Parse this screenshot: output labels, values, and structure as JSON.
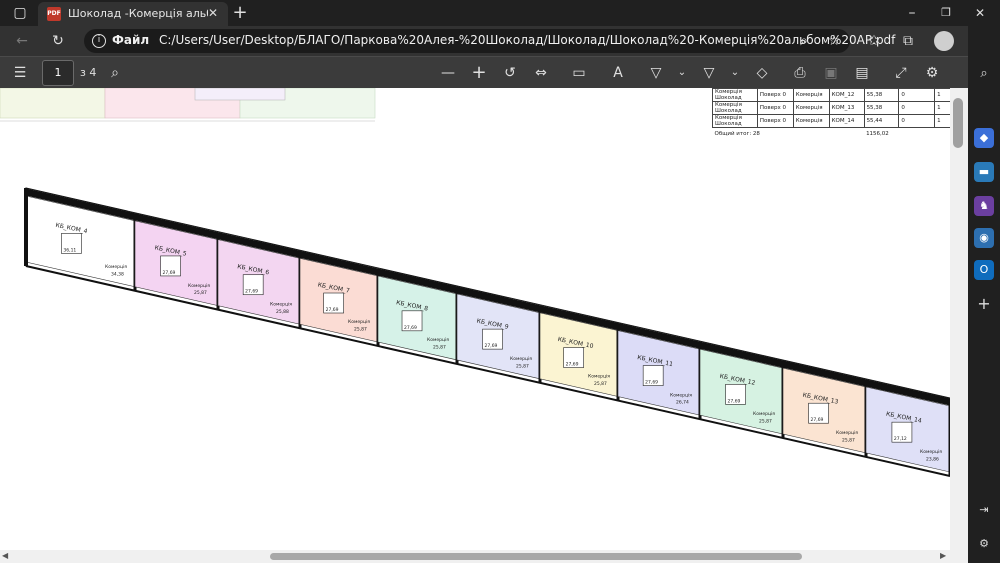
{
  "tab": {
    "title": "Шоколад -Комерція альбом АР"
  },
  "address": {
    "label": "Файл",
    "url": "C:/Users/User/Desktop/БЛАГО/Паркова%20Алея-%20Шоколад/Шоколад/Шоколад%20-Комерція%20альбом%20АР.pdf"
  },
  "pdf": {
    "page": "1",
    "of": "з 4"
  },
  "schedule": {
    "rows": [
      {
        "a": "Комерція Шоколад",
        "b": "Поверх 0",
        "c": "Комерція",
        "d": "КОМ_12",
        "e": "55,38",
        "f": "0",
        "g": "1"
      },
      {
        "a": "Комерція Шоколад",
        "b": "Поверх 0",
        "c": "Комерція",
        "d": "КОМ_13",
        "e": "55,38",
        "f": "0",
        "g": "1"
      },
      {
        "a": "Комерція Шоколад",
        "b": "Поверх 0",
        "c": "Комерція",
        "d": "КОМ_14",
        "e": "55,44",
        "f": "0",
        "g": "1"
      }
    ],
    "total_label": "Общий итог: 28",
    "total_value": "1156,02"
  },
  "units": [
    {
      "name": "КБ_КОМ_4",
      "area": "36,11",
      "label": "Комерція",
      "label_area": "34,38",
      "color": "#ffffff"
    },
    {
      "name": "КБ_КОМ_5",
      "area": "27,69",
      "label": "Комерція",
      "label_area": "25,87",
      "color": "#f4d4f2"
    },
    {
      "name": "КБ_КОМ_6",
      "area": "27,69",
      "label": "Комерція",
      "label_area": "25,88",
      "color": "#f3d6f1"
    },
    {
      "name": "КБ_КОМ_7",
      "area": "27,69",
      "label": "Комерція",
      "label_area": "25,87",
      "color": "#fbdcd4"
    },
    {
      "name": "КБ_КОМ_8",
      "area": "27,69",
      "label": "Комерція",
      "label_area": "25,87",
      "color": "#d6f2e8"
    },
    {
      "name": "КБ_КОМ_9",
      "area": "27,69",
      "label": "Комерція",
      "label_area": "25,87",
      "color": "#e2e4f7"
    },
    {
      "name": "КБ_КОМ_10",
      "area": "27,69",
      "label": "Комерція",
      "label_area": "25,87",
      "color": "#fbf4d2"
    },
    {
      "name": "КБ_КОМ_11",
      "area": "27,69",
      "label": "Комерція",
      "label_area": "26,74",
      "color": "#dcdcf7"
    },
    {
      "name": "КБ_КОМ_12",
      "area": "27,69",
      "label": "Комерція",
      "label_area": "25,87",
      "color": "#d6f2e2"
    },
    {
      "name": "КБ_КОМ_13",
      "area": "27,69",
      "label": "Комерція",
      "label_area": "25,87",
      "color": "#fbe4d2"
    },
    {
      "name": "КБ_КОМ_14",
      "area": "27,12",
      "label": "Комерція",
      "label_area": "23,86",
      "color": "#dfe0f7"
    }
  ],
  "icons": [
    "sidebar-toggle-icon",
    "back-icon",
    "refresh-icon",
    "info-icon",
    "zoom-icon",
    "star-add-icon",
    "favorites-icon",
    "collections-icon",
    "profile-icon",
    "contents-icon",
    "search-icon",
    "zoom-out-icon",
    "zoom-in-icon",
    "rotate-icon",
    "fit-icon",
    "page-view-icon",
    "read-aloud-icon",
    "draw-icon",
    "highlight-icon",
    "eraser-icon",
    "print-icon",
    "save-icon",
    "save-as-icon",
    "fullscreen-icon",
    "settings-icon"
  ]
}
